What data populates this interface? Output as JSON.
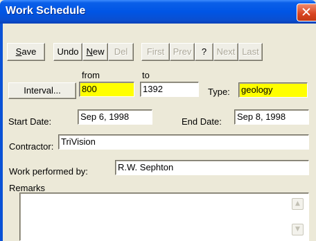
{
  "window": {
    "title": "Work Schedule",
    "close_glyph": "✕"
  },
  "toolbar": {
    "save": {
      "first": "S",
      "rest": "ave"
    },
    "undo": "Undo",
    "new": {
      "first": "N",
      "rest": "ew"
    },
    "del": "Del",
    "first": "First",
    "prev": "Prev",
    "help": "?",
    "next": "Next",
    "last": "Last"
  },
  "form": {
    "from_label": "from",
    "to_label": "to",
    "interval_button": "Interval...",
    "from_value": "800",
    "to_value": "1392",
    "type_label": "Type:",
    "type_value": "geology",
    "start_date_label": "Start Date:",
    "start_date_value": "Sep 6, 1998",
    "end_date_label": "End Date:",
    "end_date_value": "Sep 8, 1998",
    "contractor_label": "Contractor:",
    "contractor_value": "TriVision",
    "work_performed_label": "Work performed by:",
    "work_performed_value": "R.W. Sephton",
    "remarks_label": "Remarks",
    "remarks_value": ""
  },
  "colors": {
    "required_field": "#ffff00",
    "title_bar": "#0055e5",
    "close_button": "#d8431f"
  }
}
